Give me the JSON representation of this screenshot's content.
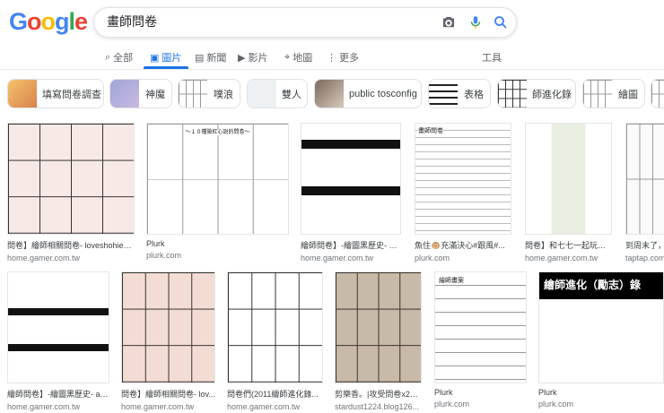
{
  "logo": "Google",
  "search": {
    "query": "畫師問卷"
  },
  "tabs": [
    {
      "label": "全部",
      "icon": "search-icon"
    },
    {
      "label": "圖片",
      "icon": "image-icon"
    },
    {
      "label": "新聞",
      "icon": "news-icon"
    },
    {
      "label": "影片",
      "icon": "video-icon"
    },
    {
      "label": "地圖",
      "icon": "map-pin-icon"
    },
    {
      "label": "更多",
      "icon": "more-vert-icon"
    }
  ],
  "tools_label": "工具",
  "chips": [
    "填寫問卷調查",
    "神魔",
    "噗浪",
    "雙人",
    "public tosconfig",
    "表格",
    "師進化錄",
    "繪圖"
  ],
  "results_row1": [
    {
      "title": "問卷】繪師相關問卷- loveshohie的...",
      "source": "home.gamer.com.tw"
    },
    {
      "title": "Plurk",
      "source": "plurk.com"
    },
    {
      "title": "繪師問卷】-繪圖黑歷史- aa...",
      "source": "home.gamer.com.tw"
    },
    {
      "title": "魚住🐵充滿決心#跟風#...",
      "source": "plurk.com"
    },
    {
      "title": "問卷】和七七一起玩的...",
      "source": "home.gamer.com.tw"
    },
    {
      "title": "到周末了，...",
      "source": "taptap.com"
    }
  ],
  "results_row2": [
    {
      "title": "繪師問卷】-繪圖黑歷史- aa...",
      "source": "home.gamer.com.tw"
    },
    {
      "title": "問卷】繪師相關問卷- lov...",
      "source": "home.gamer.com.tw"
    },
    {
      "title": "問卷們(2011繪師進化錄...",
      "source": "home.gamer.com.tw"
    },
    {
      "title": "剪樂香。|攻受問卷x2、...",
      "source": "stardust1224.blog126..."
    },
    {
      "title": "Plurk",
      "source": "plurk.com"
    },
    {
      "title": "Plurk",
      "source": "plurk.com"
    }
  ],
  "thumb_text": {
    "a": "～１０種險紅心說的問卷～",
    "b": "繪師進化（勵志）錄",
    "c": "畫師問卷",
    "d": "繪師畫案"
  }
}
